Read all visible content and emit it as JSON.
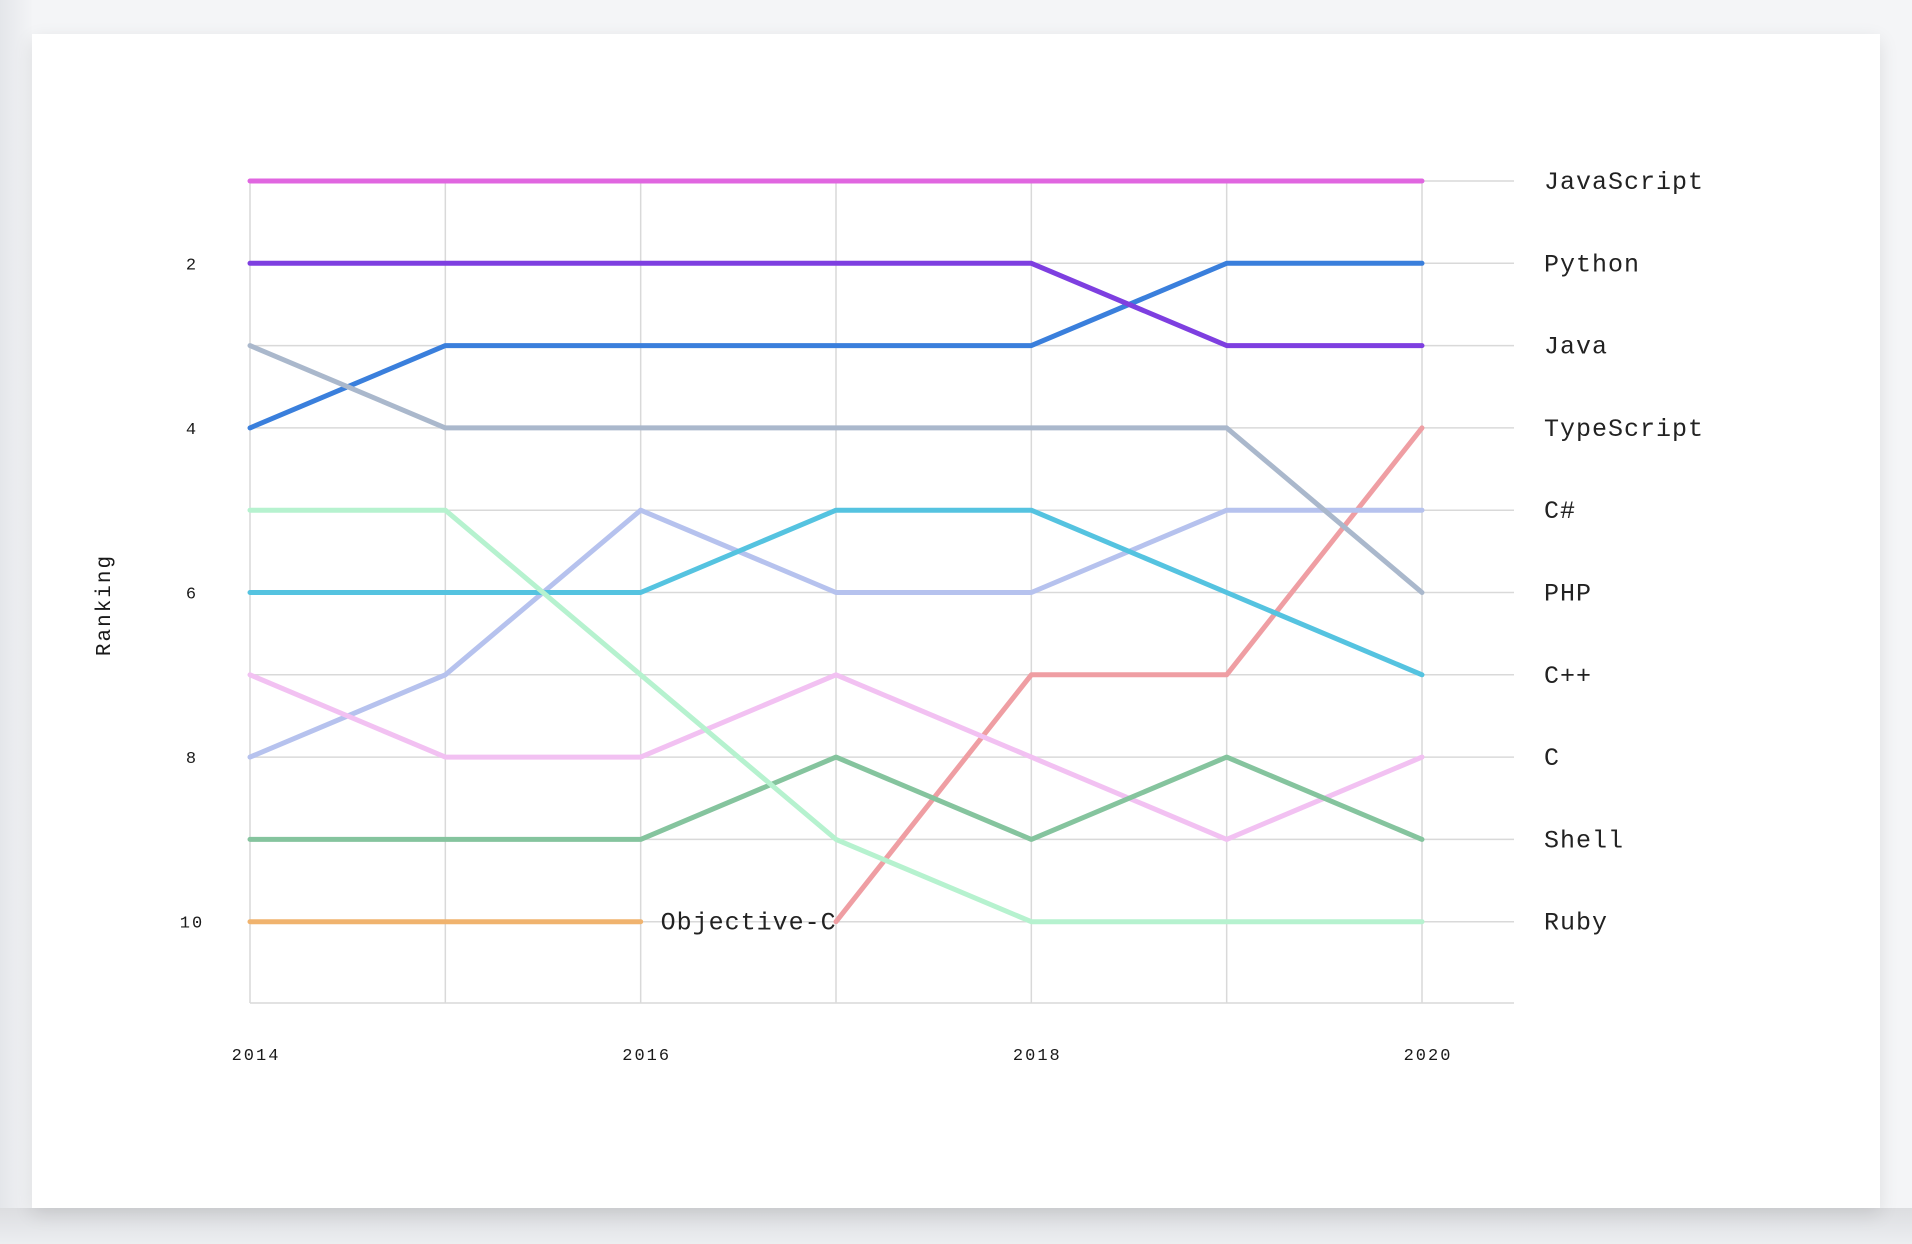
{
  "chart_data": {
    "type": "line",
    "ylabel": "Ranking",
    "xlabel": "",
    "x": [
      2014,
      2015,
      2016,
      2017,
      2018,
      2019,
      2020
    ],
    "xticks": [
      "2014",
      "2016",
      "2018",
      "2020"
    ],
    "yticks": [
      "2",
      "4",
      "6",
      "8",
      "10"
    ],
    "ylim": [
      11,
      1
    ],
    "grid": true,
    "legend": "right-end labels",
    "series": [
      {
        "name": "JavaScript",
        "color": "#e066e0",
        "values": [
          1,
          1,
          1,
          1,
          1,
          1,
          1
        ]
      },
      {
        "name": "Python",
        "color": "#3a7fdc",
        "values": [
          4,
          3,
          3,
          3,
          3,
          2,
          2
        ]
      },
      {
        "name": "Java",
        "color": "#7e3fe0",
        "values": [
          2,
          2,
          2,
          2,
          2,
          3,
          3
        ]
      },
      {
        "name": "TypeScript",
        "color": "#ef9ea3",
        "values": [
          null,
          null,
          null,
          10,
          7,
          7,
          4
        ]
      },
      {
        "name": "C#",
        "color": "#b6c2ee",
        "values": [
          8,
          7,
          5,
          6,
          6,
          5,
          5
        ]
      },
      {
        "name": "PHP",
        "color": "#aab8cc",
        "values": [
          3,
          4,
          4,
          4,
          4,
          4,
          6
        ]
      },
      {
        "name": "C++",
        "color": "#55c3e0",
        "values": [
          6,
          6,
          6,
          5,
          5,
          6,
          7
        ]
      },
      {
        "name": "C",
        "color": "#f2c1f2",
        "values": [
          7,
          8,
          8,
          7,
          8,
          9,
          8
        ]
      },
      {
        "name": "Shell",
        "color": "#85c49e",
        "values": [
          9,
          9,
          9,
          8,
          9,
          8,
          9
        ]
      },
      {
        "name": "Ruby",
        "color": "#b6f2cf",
        "values": [
          5,
          5,
          7,
          9,
          10,
          10,
          10
        ]
      },
      {
        "name": "Objective-C",
        "color": "#f0b36e",
        "values": [
          10,
          10,
          10,
          null,
          null,
          null,
          null
        ]
      }
    ]
  }
}
